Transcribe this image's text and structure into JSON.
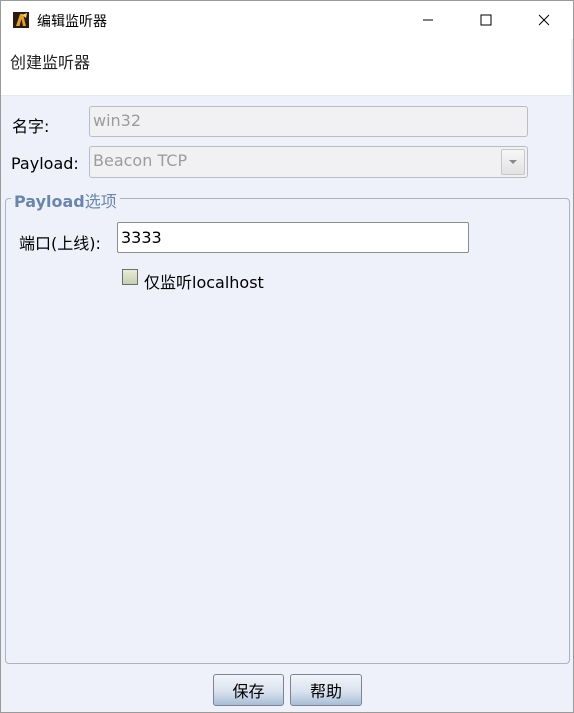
{
  "window": {
    "title": "编辑监听器",
    "app_icon": "app-icon",
    "controls": [
      "minimize-icon",
      "maximize-icon",
      "close-icon"
    ]
  },
  "header": {
    "title": "创建监听器"
  },
  "form": {
    "name_label": "名字:",
    "name_value": "win32",
    "payload_label": "Payload:",
    "payload_value": "Beacon TCP"
  },
  "options": {
    "legend_bold": "Payload",
    "legend_rest": "选项",
    "port_label": "端口(上线):",
    "port_value": "3333",
    "localhost_label": "仅监听localhost",
    "localhost_checked": false
  },
  "buttons": {
    "save": "保存",
    "help": "帮助"
  },
  "colors": {
    "background": "#eef1fa",
    "legend": "#6a86a8",
    "button_accent": "#a9bdd6"
  }
}
